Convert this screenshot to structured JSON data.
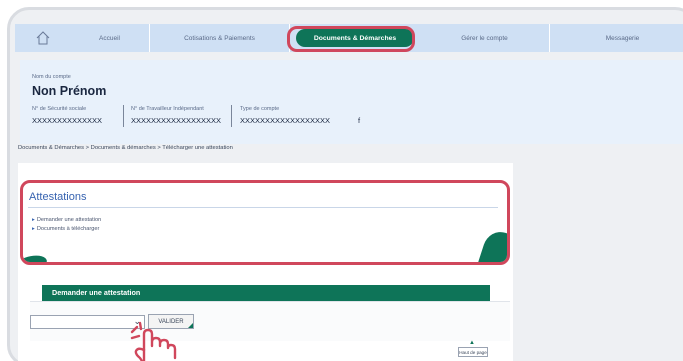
{
  "nav": {
    "items": [
      "Accueil",
      "Cotisations & Paiements",
      "Documents & Démarches",
      "Gérer le compte",
      "Messagerie"
    ]
  },
  "account": {
    "name_label": "Nom du compte",
    "name": "Non Prénom",
    "ss_label": "N° de Sécurité sociale",
    "ss_value": "XXXXXXXXXXXXXX",
    "ti_label": "N° de Travailleur Indépendant",
    "ti_value": "XXXXXXXXXXXXXXXXXX",
    "type_label": "Type de compte",
    "type_value": "XXXXXXXXXXXXXXXXXX",
    "type_suffix": "f"
  },
  "breadcrumb": "Documents & Démarches > Documents & démarches > Télécharger une attestation",
  "attestations": {
    "title": "Attestations",
    "links": [
      "Demander une attestation",
      "Documents à télécharger"
    ]
  },
  "form": {
    "section_title": "Demander une attestation",
    "select_value": "",
    "submit_label": "VALIDER",
    "back_to_top": "Haut de page"
  },
  "colors": {
    "accent_green": "#0e7458",
    "highlight_red": "#d0475c",
    "nav_blue": "#cfe0f4",
    "title_blue": "#3763b0"
  }
}
